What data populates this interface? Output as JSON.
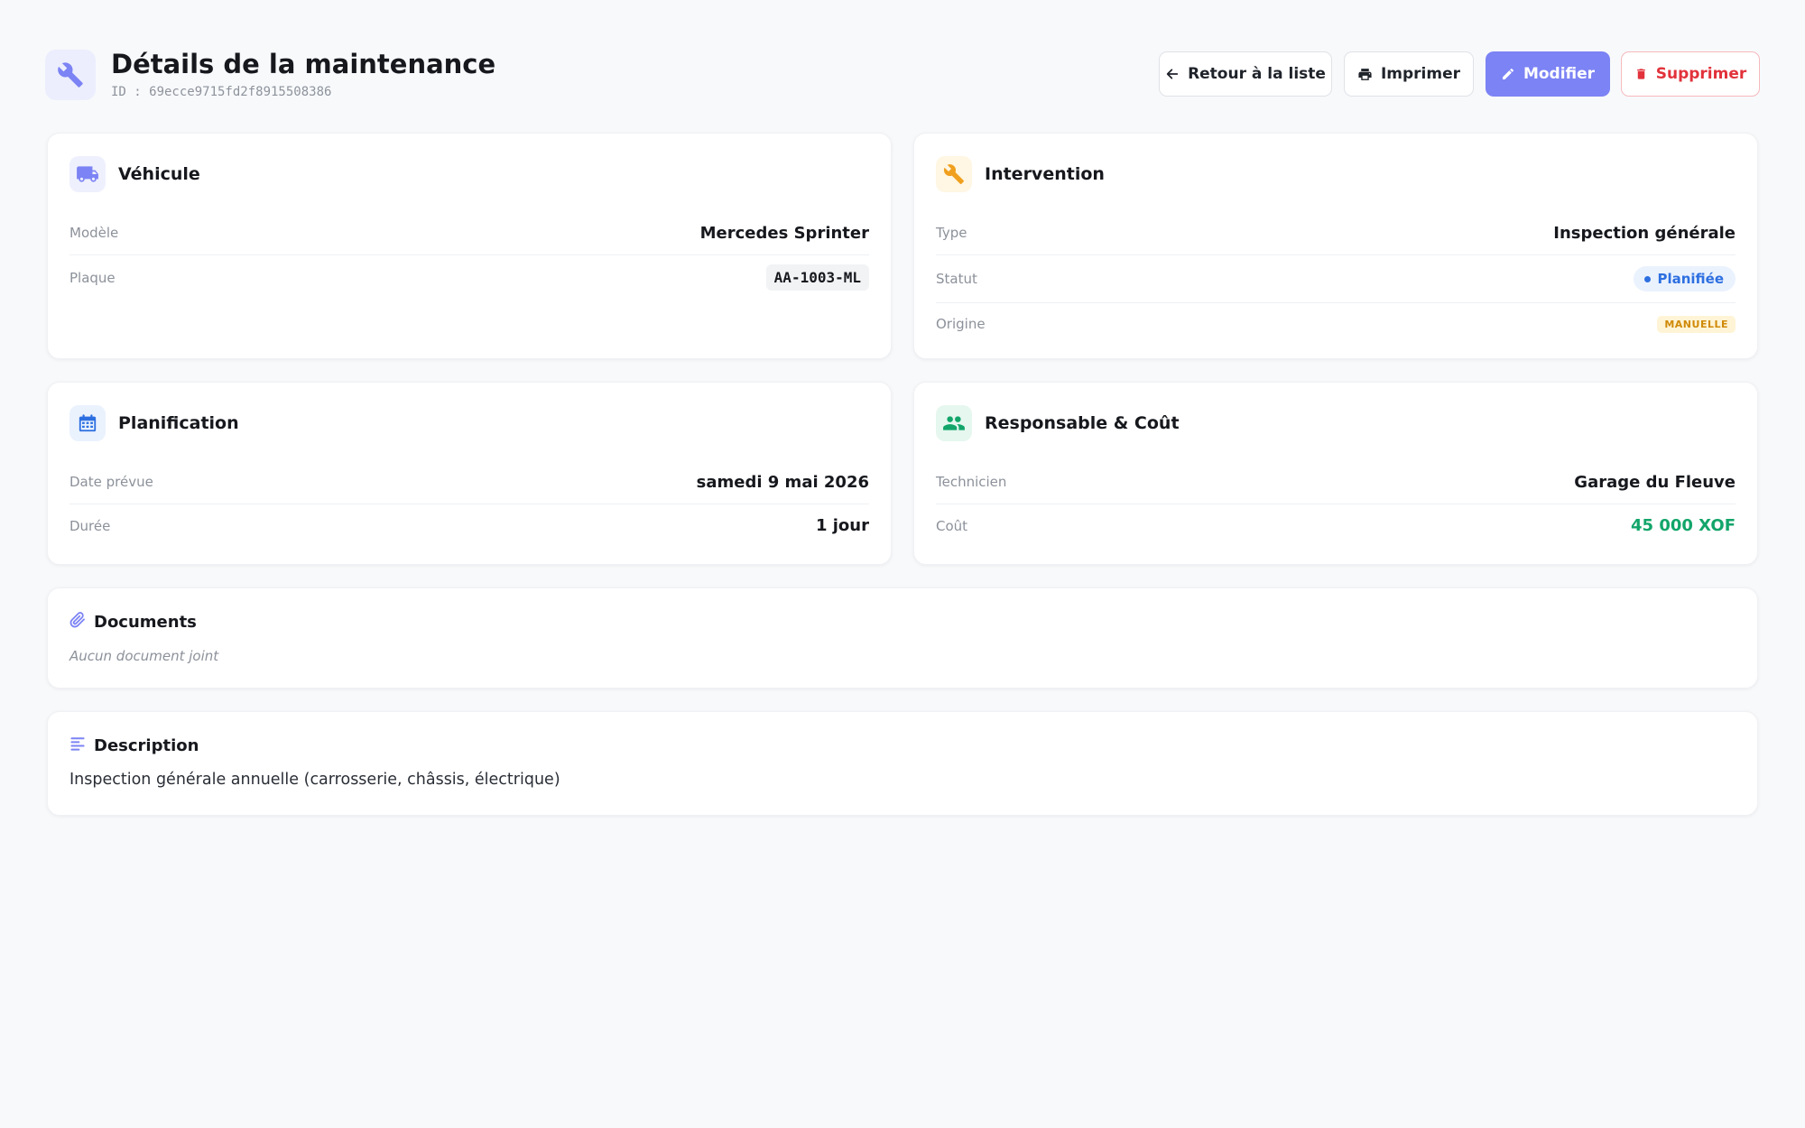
{
  "header": {
    "title": "Détails de la maintenance",
    "id_text": "ID : 69ecce9715fd2f8915508386",
    "icon": "wrench-icon",
    "accent_color": "#7c83f4"
  },
  "actions": {
    "back_label": "Retour à la liste",
    "print_label": "Imprimer",
    "edit_label": "Modifier",
    "delete_label": "Supprimer"
  },
  "vehicle": {
    "title": "Véhicule",
    "icon": "truck-icon",
    "model_label": "Modèle",
    "model_value": "Mercedes Sprinter",
    "plate_label": "Plaque",
    "plate_value": "AA-1003-ML"
  },
  "intervention": {
    "title": "Intervention",
    "icon": "wrench-icon",
    "type_label": "Type",
    "type_value": "Inspection générale",
    "status_label": "Statut",
    "status_value": "Planifiée",
    "status_color": "#2d6fe0",
    "origin_label": "Origine",
    "origin_value": "MANUELLE"
  },
  "planning": {
    "title": "Planification",
    "icon": "calendar-icon",
    "date_label": "Date prévue",
    "date_value": "samedi 9 mai 2026",
    "duration_label": "Durée",
    "duration_value": "1 jour"
  },
  "responsible": {
    "title": "Responsable & Coût",
    "icon": "users-icon",
    "technician_label": "Technicien",
    "technician_value": "Garage du Fleuve",
    "cost_label": "Coût",
    "cost_value": "45 000 XOF",
    "cost_color": "#12a56a"
  },
  "documents": {
    "title": "Documents",
    "icon": "paperclip-icon",
    "empty_text": "Aucun document joint"
  },
  "description": {
    "title": "Description",
    "icon": "align-left-icon",
    "text": "Inspection générale annuelle (carrosserie, châssis, électrique)"
  }
}
